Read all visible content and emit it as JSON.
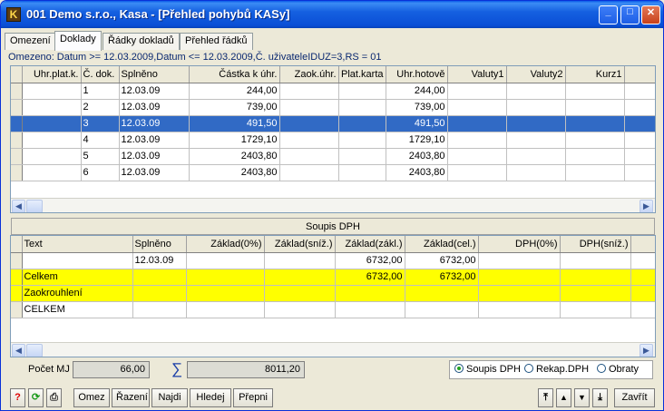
{
  "window": {
    "title": "001 Demo s.r.o., Kasa - [Přehled pohybů KASy]",
    "icon_letter": "K",
    "min": "_",
    "max": "□",
    "close": "✕"
  },
  "tabs": [
    {
      "label": "Omezení"
    },
    {
      "label": "Doklady"
    },
    {
      "label": "Řádky dokladů"
    },
    {
      "label": "Přehled řádků"
    }
  ],
  "filter_text": "Omezeno: Datum >= 12.03.2009,Datum <= 12.03.2009,Č. uživateleIDUZ=3,RS = 01",
  "doklady": {
    "headers": [
      "Uhr.plat.k.",
      "Č. dok.",
      "Splněno",
      "Částka k úhr.",
      "Zaok.úhr.",
      "Plat.karta",
      "Uhr.hotově",
      "Valuty1",
      "Valuty2",
      "Kurz1",
      "K"
    ],
    "rows": [
      [
        "",
        "1",
        "12.03.09",
        "244,00",
        "",
        "",
        "244,00",
        "",
        "",
        "",
        ""
      ],
      [
        "",
        "2",
        "12.03.09",
        "739,00",
        "",
        "",
        "739,00",
        "",
        "",
        "",
        ""
      ],
      [
        "",
        "3",
        "12.03.09",
        "491,50",
        "",
        "",
        "491,50",
        "",
        "",
        "",
        ""
      ],
      [
        "",
        "4",
        "12.03.09",
        "1729,10",
        "",
        "",
        "1729,10",
        "",
        "",
        "",
        ""
      ],
      [
        "",
        "5",
        "12.03.09",
        "2403,80",
        "",
        "",
        "2403,80",
        "",
        "",
        "",
        ""
      ],
      [
        "",
        "6",
        "12.03.09",
        "2403,80",
        "",
        "",
        "2403,80",
        "",
        "",
        "",
        ""
      ]
    ],
    "selected_row": 2
  },
  "soupis": {
    "title": "Soupis DPH",
    "headers": [
      "Text",
      "Splněno",
      "Základ(0%)",
      "Základ(sníž.)",
      "Základ(zákl.)",
      "Základ(cel.)",
      "DPH(0%)",
      "DPH(sníž.)",
      "D"
    ],
    "rows": [
      [
        "",
        "12.03.09",
        "",
        "",
        "6732,00",
        "6732,00",
        "",
        "",
        ""
      ],
      [
        "Celkem",
        "",
        "",
        "",
        "6732,00",
        "6732,00",
        "",
        "",
        ""
      ],
      [
        "Zaokrouhlení",
        "",
        "",
        "",
        "",
        "",
        "",
        "",
        ""
      ],
      [
        "CELKEM",
        "",
        "",
        "",
        "",
        "",
        "",
        "",
        ""
      ]
    ]
  },
  "stats": {
    "pocet_label": "Počet MJ",
    "pocet_value": "66,00",
    "sum_symbol": "∑",
    "sum_value": "8011,20"
  },
  "radios": [
    {
      "label": "Soupis DPH",
      "checked": true
    },
    {
      "label": "Rekap.DPH",
      "checked": false
    },
    {
      "label": "Obraty",
      "checked": false
    }
  ],
  "toolbar": {
    "help": "?",
    "refresh": "⟳",
    "print": "⎙",
    "omez": "Omez",
    "razeni": "Řazení",
    "najdi": "Najdi",
    "hledej": "Hledej",
    "prepni": "Přepni",
    "first": "⤒",
    "up": "▲",
    "down": "▼",
    "last": "⤓",
    "close": "Zavřít"
  },
  "colors": {
    "selection": "#316ac5",
    "highlight": "#ffff00",
    "titlebar": "#0a4fd6"
  }
}
